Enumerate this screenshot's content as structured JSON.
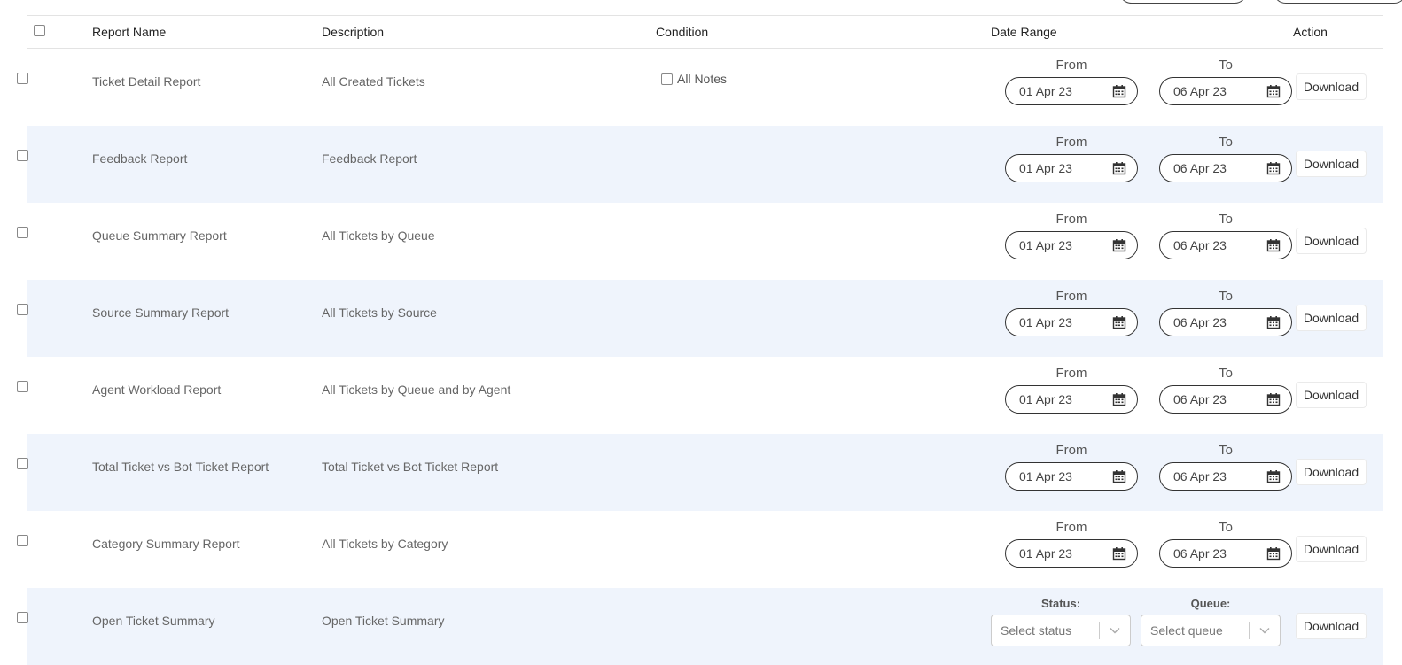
{
  "header": {
    "report_name": "Report Name",
    "description": "Description",
    "condition": "Condition",
    "date_range": "Date Range",
    "action": "Action"
  },
  "date_labels": {
    "from": "From",
    "to": "To"
  },
  "download_label": "Download",
  "rows": [
    {
      "name": "Ticket Detail Report",
      "description": "All Created Tickets",
      "condition": "All Notes",
      "from": "01 Apr 23",
      "to": "06 Apr 23"
    },
    {
      "name": "Feedback Report",
      "description": "Feedback Report",
      "from": "01 Apr 23",
      "to": "06 Apr 23"
    },
    {
      "name": "Queue Summary Report",
      "description": "All Tickets by Queue",
      "from": "01 Apr 23",
      "to": "06 Apr 23"
    },
    {
      "name": "Source Summary Report",
      "description": "All Tickets by Source",
      "from": "01 Apr 23",
      "to": "06 Apr 23"
    },
    {
      "name": "Agent Workload Report",
      "description": "All Tickets by Queue and by Agent",
      "from": "01 Apr 23",
      "to": "06 Apr 23"
    },
    {
      "name": "Total Ticket vs Bot Ticket Report",
      "description": "Total Ticket vs Bot Ticket Report",
      "from": "01 Apr 23",
      "to": "06 Apr 23"
    },
    {
      "name": "Category Summary Report",
      "description": "All Tickets by Category",
      "from": "01 Apr 23",
      "to": "06 Apr 23"
    },
    {
      "name": "Open Ticket Summary",
      "description": "Open Ticket Summary",
      "status_label": "Status:",
      "status_placeholder": "Select status",
      "queue_label": "Queue:",
      "queue_placeholder": "Select queue"
    }
  ]
}
